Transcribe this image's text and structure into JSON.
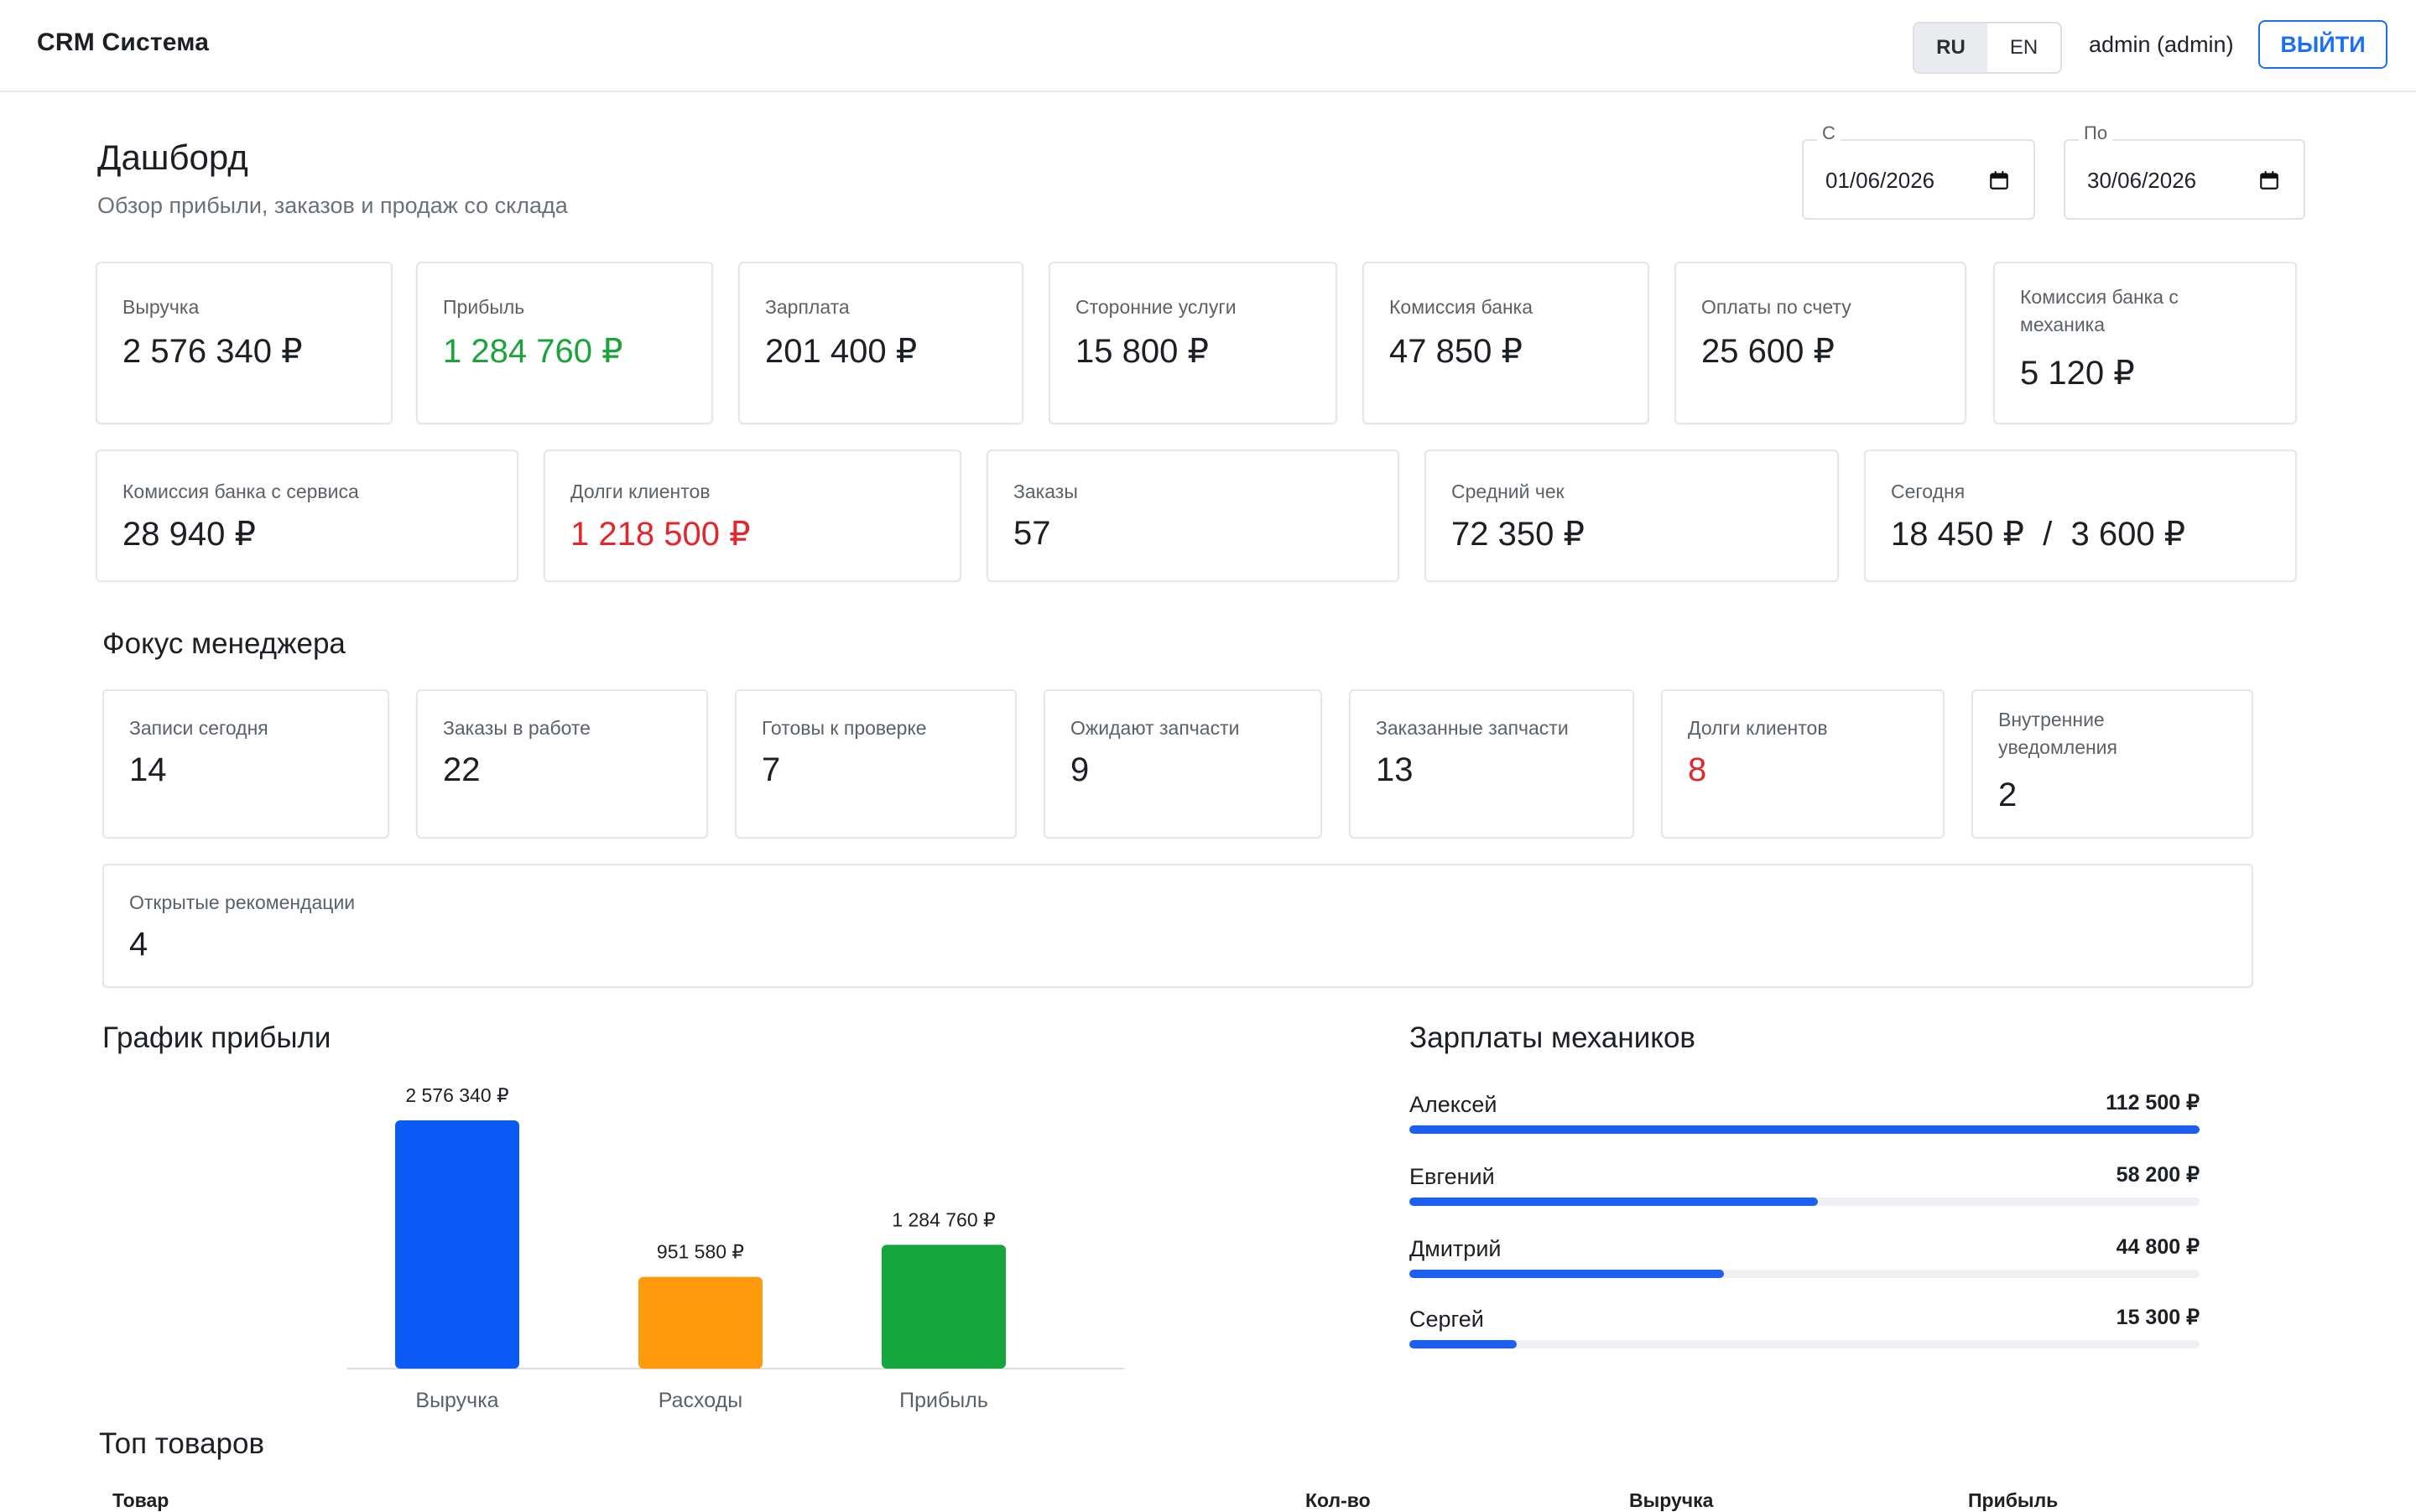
{
  "header": {
    "brand": "CRM Система",
    "lang_ru": "RU",
    "lang_en": "EN",
    "active_lang": "RU",
    "user": "admin (admin)",
    "logout": "ВЫЙТИ"
  },
  "page": {
    "title": "Дашборд",
    "subtitle": "Обзор прибыли, заказов и продаж со склада"
  },
  "filters": {
    "from_label": "С",
    "from_value": "01/06/2026",
    "to_label": "По",
    "to_value": "30/06/2026"
  },
  "stats_row1": [
    {
      "title": "Выручка",
      "value": "2 576 340 ₽"
    },
    {
      "title": "Прибыль",
      "value": "1 284 760 ₽"
    },
    {
      "title": "Зарплата",
      "value": "201 400 ₽"
    },
    {
      "title": "Сторонние услуги",
      "value": "15 800 ₽"
    },
    {
      "title": "Комиссия банка",
      "value": "47 850 ₽"
    },
    {
      "title": "Оплаты по счету",
      "value": "25 600 ₽"
    },
    {
      "title": "Комиссия банка с механика",
      "value": "5 120 ₽"
    }
  ],
  "stats_row2": [
    {
      "title": "Комиссия банка с сервиса",
      "value": "28 940 ₽"
    },
    {
      "title": "Долги клиентов",
      "value": "1 218 500 ₽"
    },
    {
      "title": "Заказы",
      "value": "57"
    },
    {
      "title": "Средний чек",
      "value": "72 350 ₽"
    },
    {
      "title": "Сегодня",
      "value": "18 450 ₽  /  3 600 ₽"
    }
  ],
  "focus": {
    "title": "Фокус менеджера",
    "items": [
      {
        "title": "Записи сегодня",
        "value": "14"
      },
      {
        "title": "Заказы в работе",
        "value": "22"
      },
      {
        "title": "Готовы к проверке",
        "value": "7"
      },
      {
        "title": "Ожидают запчасти",
        "value": "9"
      },
      {
        "title": "Заказанные запчасти",
        "value": "13"
      },
      {
        "title": "Долги клиентов",
        "value": "8"
      },
      {
        "title": "Внутренние уведомления",
        "value": "2"
      }
    ],
    "wide": {
      "title": "Открытые рекомендации",
      "value": "4"
    }
  },
  "profit_chart": {
    "title": "График прибыли"
  },
  "chart_data": {
    "type": "bar",
    "categories": [
      "Выручка",
      "Расходы",
      "Прибыль"
    ],
    "values": [
      2576340,
      951580,
      1284760
    ],
    "value_labels": [
      "2 576 340 ₽",
      "951 580 ₽",
      "1 284 760 ₽"
    ],
    "colors": [
      "#0a5af5",
      "#ff9a0d",
      "#15a53d"
    ],
    "ylim": [
      0,
      2576340
    ],
    "grid": false
  },
  "mechanics": {
    "title": "Зарплаты механиков",
    "max_value": 112500,
    "rows": [
      {
        "name": "Алексей",
        "amount": "112 500 ₽",
        "value": 112500
      },
      {
        "name": "Евгений",
        "amount": "58 200 ₽",
        "value": 58200
      },
      {
        "name": "Дмитрий",
        "amount": "44 800 ₽",
        "value": 44800
      },
      {
        "name": "Сергей",
        "amount": "15 300 ₽",
        "value": 15300
      }
    ]
  },
  "top_products": {
    "title": "Топ товаров",
    "columns": [
      "Товар",
      "Кол-во",
      "Выручка",
      "Прибыль"
    ]
  }
}
